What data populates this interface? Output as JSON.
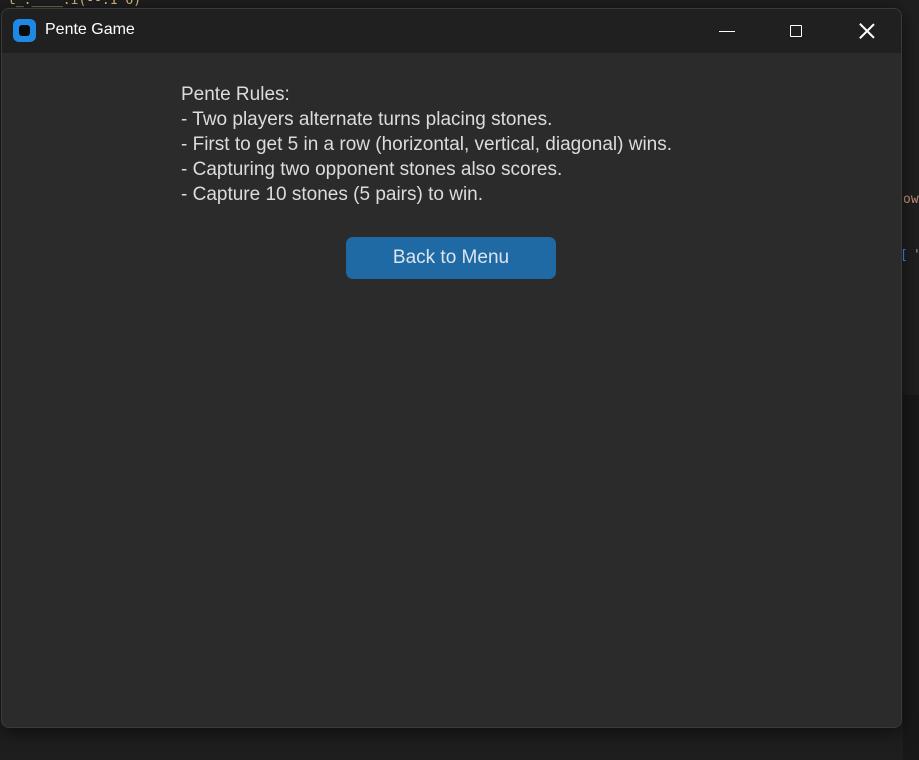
{
  "window": {
    "title": "Pente Game",
    "icon": "app-icon",
    "controls": {
      "minimize_icon": "minimize-icon",
      "maximize_icon": "maximize-icon",
      "close_icon": "close-icon"
    }
  },
  "rules": {
    "heading": "Pente Rules:",
    "lines": [
      "- Two players alternate turns placing stones.",
      "- First to get 5 in a row (horizontal, vertical, diagonal) wins.",
      "- Capturing two opponent stones also scores.",
      "- Capture 10 stones (5 pairs) to win."
    ]
  },
  "back_button": {
    "label": "Back to Menu"
  },
  "background_fragments": {
    "top_left": "t_.____.i(--.1 6)",
    "right_1": "ow",
    "right_2_bracket": "[",
    "right_2_quote": "'"
  },
  "colors": {
    "window_bg": "#2b2b2b",
    "titlebar_bg": "#202020",
    "button_bg": "#1f6aa5",
    "text": "#dcdcdc",
    "accent_icon": "#1e88e5"
  }
}
